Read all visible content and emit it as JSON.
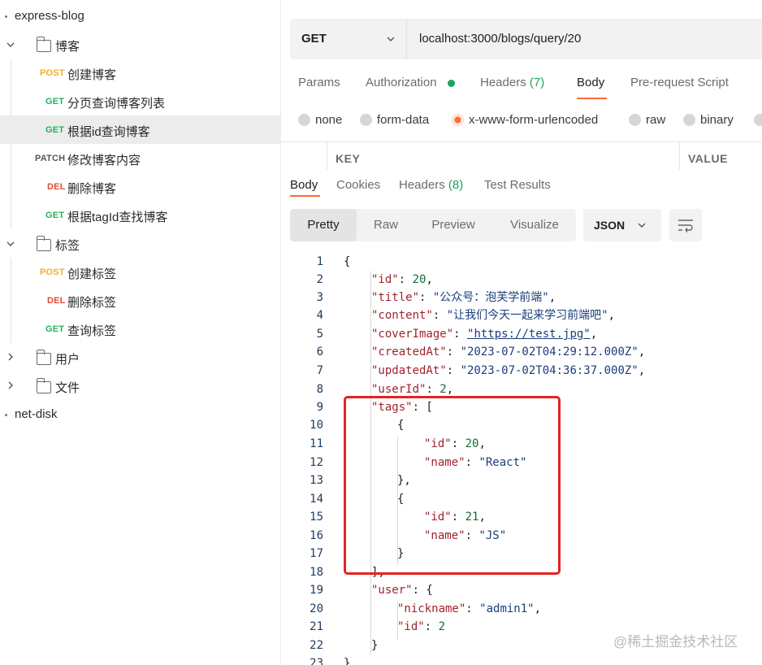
{
  "sidebar": {
    "collections": [
      {
        "name": "express-blog"
      },
      {
        "name": "net-disk"
      }
    ],
    "rows": [
      {
        "type": "folder",
        "label": "博客"
      },
      {
        "type": "request",
        "method": "POST",
        "label": "创建博客"
      },
      {
        "type": "request",
        "method": "GET",
        "label": "分页查询博客列表"
      },
      {
        "type": "request",
        "method": "GET",
        "label": "根据id查询博客"
      },
      {
        "type": "request",
        "method": "PATCH",
        "label": "修改博客内容"
      },
      {
        "type": "request",
        "method": "DEL",
        "label": "删除博客"
      },
      {
        "type": "request",
        "method": "GET",
        "label": "根据tagId查找博客"
      },
      {
        "type": "folder",
        "label": "标签"
      },
      {
        "type": "request",
        "method": "POST",
        "label": "创建标签"
      },
      {
        "type": "request",
        "method": "DEL",
        "label": "删除标签"
      },
      {
        "type": "request",
        "method": "GET",
        "label": "查询标签"
      },
      {
        "type": "folder",
        "label": "用户"
      },
      {
        "type": "folder",
        "label": "文件"
      }
    ],
    "selected_label": "根据id查询博客"
  },
  "request": {
    "method": "GET",
    "url": "localhost:3000/blogs/query/20",
    "tabs": [
      {
        "label": "Params"
      },
      {
        "label": "Authorization"
      },
      {
        "label": "Headers",
        "count": "(7)"
      },
      {
        "label": "Body"
      },
      {
        "label": "Pre-request Script"
      }
    ],
    "active_tab": "Body",
    "body_types": [
      "none",
      "form-data",
      "x-www-form-urlencoded",
      "raw",
      "binary"
    ],
    "selected_body_type": "x-www-form-urlencoded",
    "table_headers": [
      "KEY",
      "VALUE"
    ]
  },
  "response": {
    "tabs": [
      {
        "label": "Body"
      },
      {
        "label": "Cookies"
      },
      {
        "label": "Headers",
        "count": "(8)"
      },
      {
        "label": "Test Results"
      }
    ],
    "active_tab": "Body",
    "view_modes": [
      "Pretty",
      "Raw",
      "Preview",
      "Visualize"
    ],
    "active_view": "Pretty",
    "language": "JSON",
    "line_numbers": [
      "1",
      "2",
      "3",
      "4",
      "5",
      "6",
      "7",
      "8",
      "9",
      "10",
      "11",
      "12",
      "13",
      "14",
      "15",
      "16",
      "17",
      "18",
      "19",
      "20",
      "21",
      "22",
      "23"
    ],
    "json": {
      "id": "20",
      "title": "\"公众号：泡芙学前端\"",
      "content": "\"让我们今天一起来学习前端吧\"",
      "coverImage": "\"https://test.jpg\"",
      "createdAt": "\"2023-07-02T04:29:12.000Z\"",
      "updatedAt": "\"2023-07-02T04:36:37.000Z\"",
      "userId": "2",
      "tags": [
        {
          "id": "20",
          "name": "\"React\""
        },
        {
          "id": "21",
          "name": "\"JS\""
        }
      ],
      "user": {
        "nickname": "\"admin1\"",
        "id": "2"
      }
    }
  },
  "watermark": "@稀土掘金技术社区",
  "colors": {
    "accent": "#ff6c37",
    "post": "#f2b022",
    "get": "#1fb45b",
    "del": "#e24a39",
    "highlight": "#e52222"
  }
}
